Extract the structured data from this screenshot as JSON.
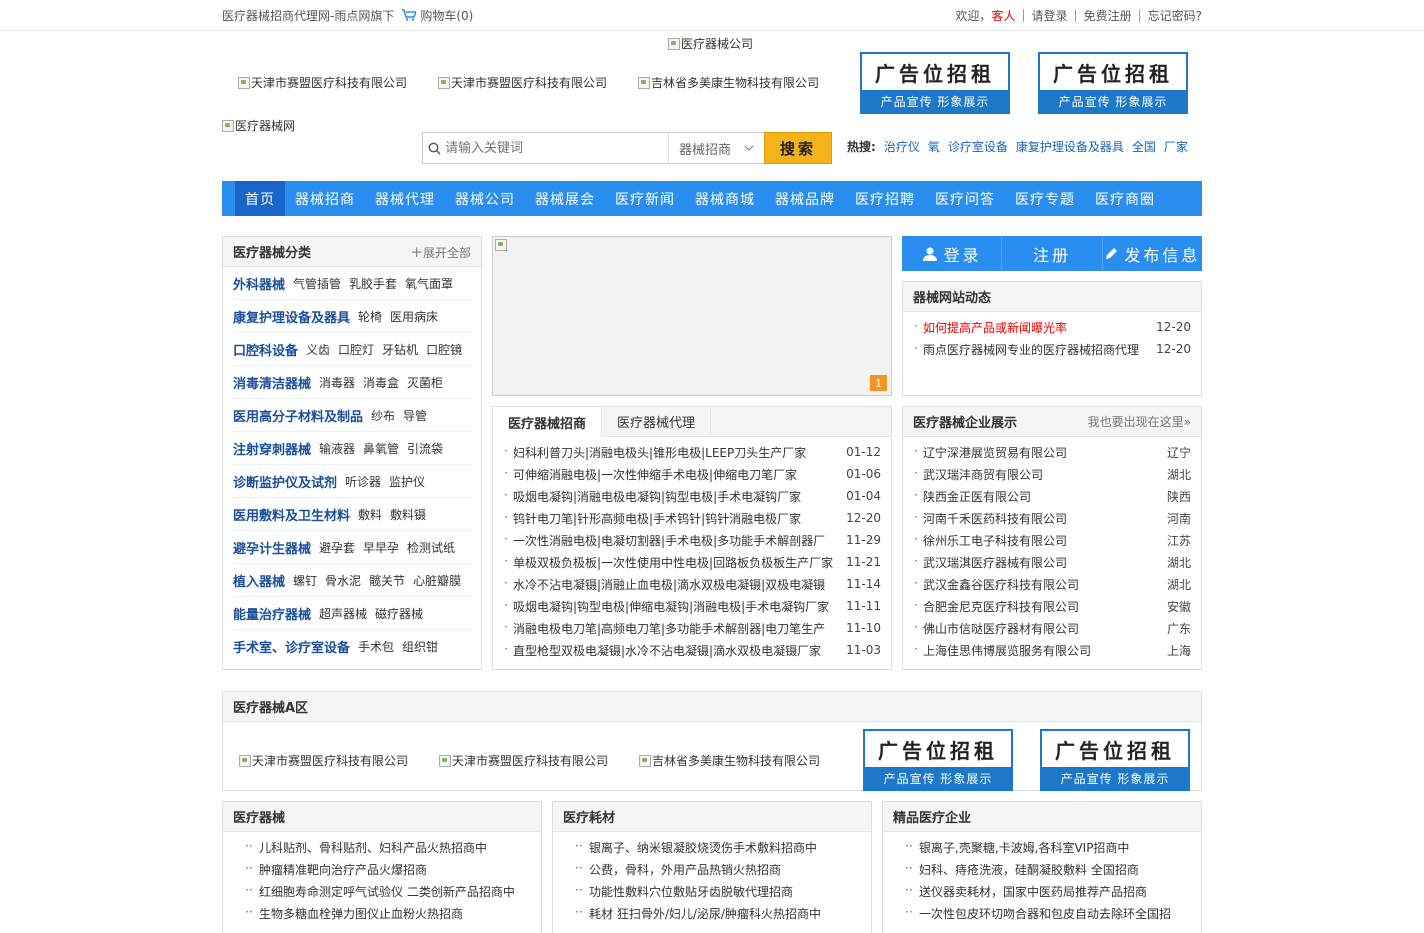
{
  "topbar": {
    "site_title": "医疗器械招商代理网-雨点网旗下",
    "cart_label": "购物车(0)",
    "welcome": "欢迎，",
    "guest": "客人",
    "login": "请登录",
    "register": "免费注册",
    "forgot": "忘记密码?"
  },
  "header": {
    "center_logo_alt": "医疗器械公司",
    "logo_alt": "医疗器械网",
    "ad_images": [
      "天津市赛盟医疗科技有限公司",
      "天津市赛盟医疗科技有限公司",
      "吉林省多美康生物科技有限公司"
    ],
    "ad_box": {
      "title": "广告位招租",
      "subtitle": "产品宣传  形象展示"
    }
  },
  "search": {
    "placeholder": "请输入关键词",
    "category": "器械招商",
    "button": "搜索",
    "hot_label": "热搜:",
    "hot_terms": [
      "治疗仪",
      "氧",
      "诊疗室设备",
      "康复护理设备及器具",
      "全国",
      "厂家"
    ]
  },
  "nav": [
    "首页",
    "器械招商",
    "器械代理",
    "器械公司",
    "器械展会",
    "医疗新闻",
    "器械商城",
    "器械品牌",
    "医疗招聘",
    "医疗问答",
    "医疗专题",
    "医疗商圈"
  ],
  "categories": {
    "title": "医疗器械分类",
    "expand": "展开全部",
    "items": [
      {
        "name": "外科器械",
        "subs": [
          "气管插管",
          "乳胶手套",
          "氧气面罩"
        ]
      },
      {
        "name": "康复护理设备及器具",
        "subs": [
          "轮椅",
          "医用病床"
        ]
      },
      {
        "name": "口腔科设备",
        "subs": [
          "义齿",
          "口腔灯",
          "牙钻机",
          "口腔镜"
        ]
      },
      {
        "name": "消毒清洁器械",
        "subs": [
          "消毒器",
          "消毒盒",
          "灭菌柜"
        ]
      },
      {
        "name": "医用高分子材料及制品",
        "subs": [
          "纱布",
          "导管"
        ]
      },
      {
        "name": "注射穿刺器械",
        "subs": [
          "输液器",
          "鼻氧管",
          "引流袋"
        ]
      },
      {
        "name": "诊断监护仪及试剂",
        "subs": [
          "听诊器",
          "监护仪"
        ]
      },
      {
        "name": "医用敷料及卫生材料",
        "subs": [
          "敷料",
          "敷料镊"
        ]
      },
      {
        "name": "避孕计生器械",
        "subs": [
          "避孕套",
          "早早孕",
          "检测试纸"
        ]
      },
      {
        "name": "植入器械",
        "subs": [
          "螺钉",
          "骨水泥",
          "髋关节",
          "心脏瓣膜"
        ]
      },
      {
        "name": "能量治疗器械",
        "subs": [
          "超声器械",
          "磁疗器械"
        ]
      },
      {
        "name": "手术室、诊疗室设备",
        "subs": [
          "手术包",
          "组织钳"
        ]
      }
    ]
  },
  "slideshow": {
    "page": "1"
  },
  "tabs": {
    "labels": [
      "医疗器械招商",
      "医疗器械代理"
    ],
    "items": [
      {
        "text": "妇科利普刀头|消融电极头|锥形电极|LEEP刀头生产厂家",
        "date": "01-12"
      },
      {
        "text": "可伸缩消融电极|一次性伸缩手术电极|伸缩电刀笔厂家",
        "date": "01-06"
      },
      {
        "text": "吸烟电凝钩|消融电极电凝钩|钩型电极|手术电凝钩厂家",
        "date": "01-04"
      },
      {
        "text": "钨针电刀笔|针形高频电极|手术钨针|钨针消融电极厂家",
        "date": "12-20"
      },
      {
        "text": "一次性消融电极|电凝切割器|手术电极|多功能手术解剖器厂",
        "date": "11-29"
      },
      {
        "text": "单极双极负极板|一次性使用中性电极|回路板负极板生产厂家",
        "date": "11-21"
      },
      {
        "text": "水冷不沾电凝镊|消融止血电极|滴水双极电凝镊|双极电凝镊",
        "date": "11-14"
      },
      {
        "text": "吸烟电凝钩|钩型电极|伸缩电凝钩|消融电极|手术电凝钩厂家",
        "date": "11-11"
      },
      {
        "text": "消融电极电刀笔|高频电刀笔|多功能手术解剖器|电刀笔生产",
        "date": "11-10"
      },
      {
        "text": "直型枪型双极电凝镊|水冷不沾电凝镊|滴水双极电凝镊厂家",
        "date": "11-03"
      }
    ]
  },
  "account": {
    "login": "登录",
    "register": "注册",
    "publish": "发布信息"
  },
  "site_news": {
    "title": "器械网站动态",
    "items": [
      {
        "text": "如何提高产品或新闻曝光率",
        "date": "12-20",
        "highlight": true
      },
      {
        "text": "雨点医疗器械网专业的医疗器械招商代理",
        "date": "12-20",
        "highlight": false
      }
    ]
  },
  "companies": {
    "title": "医疗器械企业展示",
    "more": "我也要出现在这里»",
    "items": [
      {
        "name": "辽宁深港展览贸易有限公司",
        "region": "辽宁"
      },
      {
        "name": "武汉瑞沣商贸有限公司",
        "region": "湖北"
      },
      {
        "name": "陕西金正医有限公司",
        "region": "陕西"
      },
      {
        "name": "河南千禾医药科技有限公司",
        "region": "河南"
      },
      {
        "name": "徐州乐工电子科技有限公司",
        "region": "江苏"
      },
      {
        "name": "武汉瑞淇医疗器械有限公司",
        "region": "湖北"
      },
      {
        "name": "武汉金鑫谷医疗科技有限公司",
        "region": "湖北"
      },
      {
        "name": "合肥金尼克医疗科技有限公司",
        "region": "安徽"
      },
      {
        "name": "佛山市信哒医疗器材有限公司",
        "region": "广东"
      },
      {
        "name": "上海佳思伟博展览服务有限公司",
        "region": "上海"
      }
    ]
  },
  "zone": {
    "title": "医疗器械A区",
    "ad_images": [
      "天津市赛盟医疗科技有限公司",
      "天津市赛盟医疗科技有限公司",
      "吉林省多美康生物科技有限公司"
    ]
  },
  "bottom": [
    {
      "title": "医疗器械",
      "items": [
        "儿科贴剂、骨科贴剂、妇科产品火热招商中",
        "肿瘤精准靶向治疗产品火爆招商",
        "红细胞寿命测定呼气试验仪 二类创新产品招商中",
        "生物多糖血栓弹力图仪止血粉火热招商"
      ]
    },
    {
      "title": "医疗耗材",
      "items": [
        "银离子、纳米银凝胶烧烫伤手术敷料招商中",
        "公费，骨科，外用产品热销火热招商",
        "功能性敷料穴位敷贴牙齿脱敏代理招商",
        "耗材 狂扫骨外/妇儿/泌尿/肿瘤科火热招商中"
      ]
    },
    {
      "title": "精品医疗企业",
      "items": [
        "银离子,壳聚糖,卡波姆,各科室VIP招商中",
        "妇科、痔疮洗液，硅酮凝胶敷料 全国招商",
        "送仪器卖耗材，国家中医药局推荐产品招商",
        "一次性包皮环切吻合器和包皮自动去除环全国招"
      ]
    }
  ]
}
